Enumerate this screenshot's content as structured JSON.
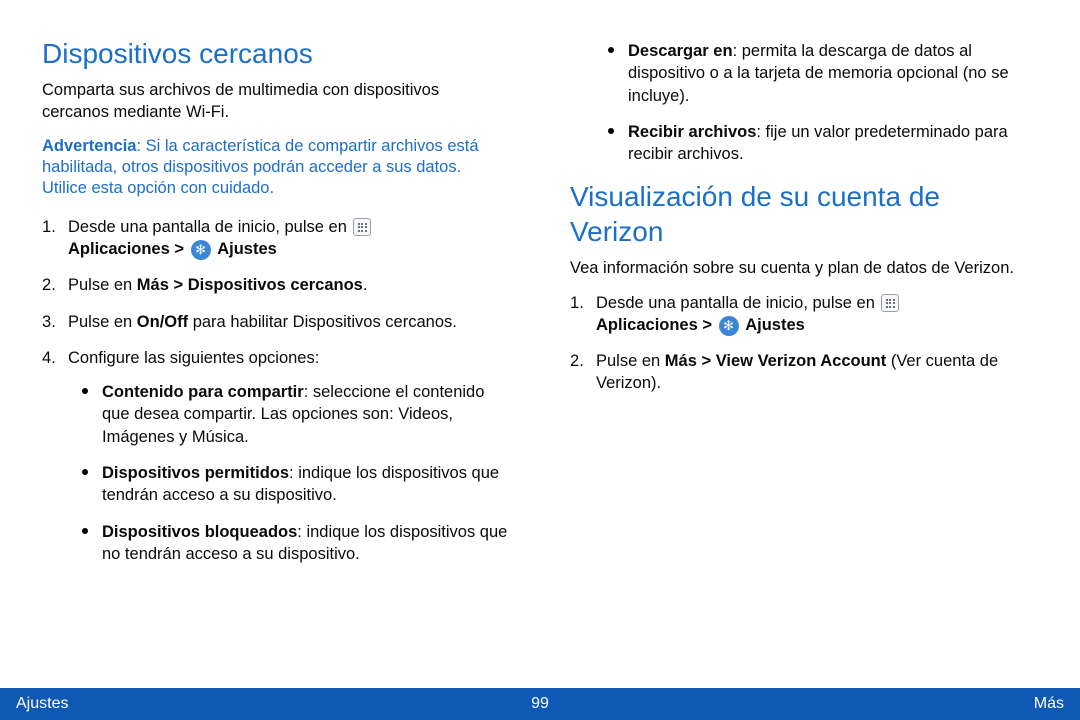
{
  "left": {
    "heading": "Dispositivos cercanos",
    "lead": "Comparta sus archivos de multimedia con dispositivos cercanos mediante Wi-Fi.",
    "warning_label": "Advertencia",
    "warning_body": ": Si la característica de compartir archivos está habilitada, otros dispositivos podrán acceder a sus datos. Utilice esta opción con cuidado.",
    "step1_a": "Desde una pantalla de inicio, pulse en ",
    "step1_b": "Aplicaciones > ",
    "step1_c": " Ajustes",
    "step2_a": "Pulse en ",
    "step2_b": "Más > Dispositivos cercanos",
    "step2_c": ".",
    "step3_a": "Pulse en ",
    "step3_b": "On/Off",
    "step3_c": " para habilitar Dispositivos cercanos.",
    "step4": "Configure las siguientes opciones:",
    "opt1_label": "Contenido para compartir",
    "opt1_body": ": seleccione el contenido que desea compartir. Las opciones son: Videos, Imágenes y Música.",
    "opt2_label": "Dispositivos permitidos",
    "opt2_body": ": indique los dispositivos que tendrán acceso a su dispositivo.",
    "opt3_label": "Dispositivos bloqueados",
    "opt3_body": ": indique los dispositivos que no tendrán acceso a su dispositivo."
  },
  "right": {
    "optA_label": "Descargar en",
    "optA_body": ": permita la descarga de datos al dispositivo o a la tarjeta de memoria opcional (no se incluye).",
    "optB_label": "Recibir archivos",
    "optB_body": ": fije un valor predeterminado para recibir archivos.",
    "heading": "Visualización de su cuenta de Verizon",
    "lead": "Vea información sobre su cuenta y plan de datos de Verizon.",
    "step1_a": "Desde una pantalla de inicio, pulse en ",
    "step1_b": "Aplicaciones > ",
    "step1_c": " Ajustes",
    "step2_a": "Pulse en ",
    "step2_b": "Más > View Verizon Account",
    "step2_c": " (Ver cuenta de Verizon)."
  },
  "footer": {
    "left": "Ajustes",
    "center": "99",
    "right": "Más"
  }
}
